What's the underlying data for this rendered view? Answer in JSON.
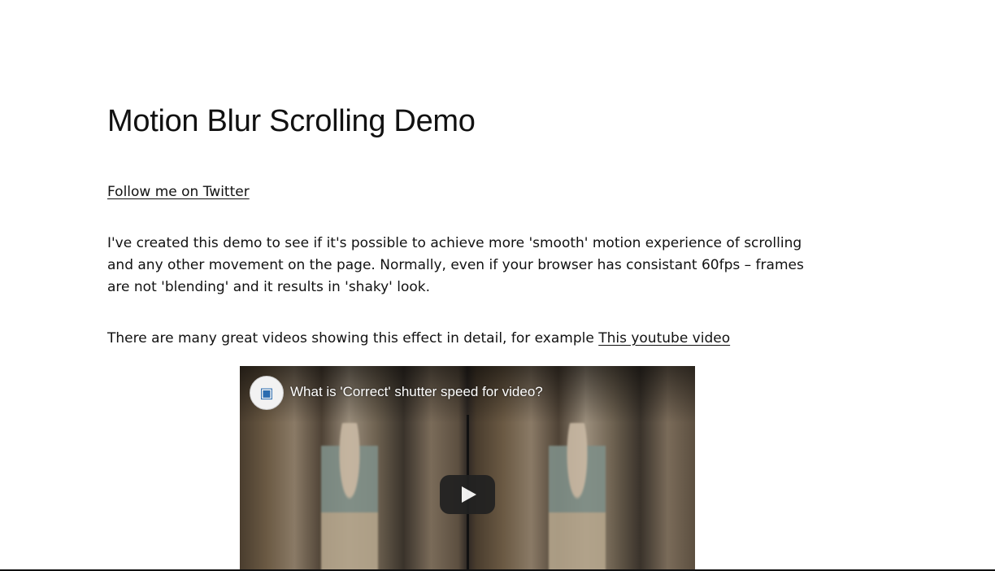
{
  "page": {
    "title": "Motion Blur Scrolling Demo",
    "twitter_link": "Follow me on Twitter",
    "intro": "I've created this demo to see if it's possible to achieve more 'smooth' motion experience of scrolling and any other movement on the page. Normally, even if your browser has consistant 60fps – frames are not 'blending' and it results in 'shaky' look.",
    "videos_text": "There are many great videos showing this effect in detail, for example ",
    "youtube_link": "This youtube video"
  },
  "video": {
    "title": "What is 'Correct' shutter speed for video?",
    "channel_avatar_icon": "channel-avatar-icon",
    "play_icon": "play-icon"
  }
}
